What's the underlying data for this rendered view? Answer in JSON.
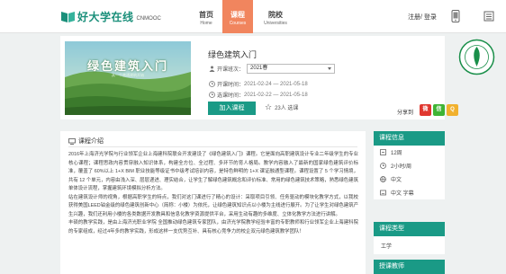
{
  "header": {
    "logo_text": "好大学在线",
    "logo_sub": "CNMOOC",
    "nav": [
      {
        "zh": "首页",
        "en": "Home"
      },
      {
        "zh": "课程",
        "en": "Courses"
      },
      {
        "zh": "院校",
        "en": "Universities"
      }
    ],
    "login_label": "注册/ 登录",
    "colors": {
      "brand": "#1a8f7a",
      "active_tab": "#f1855e"
    }
  },
  "course": {
    "thumbnail_title": "绿色建筑入门",
    "thumbnail_subtitle": "从一个普通建筑开始",
    "title": "绿色建筑入门",
    "term_label": "开课班次：",
    "term_value": "2021春",
    "start_label": "开课时间：",
    "start_value": "2021-02-24 — 2021-05-18",
    "elective_label": "选课时间：",
    "elective_value": "2021-02-22 — 2021-05-18",
    "join_button": "加入课程",
    "enrolled_count": "23人 选课",
    "share_label": "分享到",
    "share_buttons": [
      {
        "icon": "weibo-icon",
        "glyph": "微",
        "color": "#e0372f"
      },
      {
        "icon": "wechat-icon",
        "glyph": "信",
        "color": "#3fb435"
      },
      {
        "icon": "qq-zone-icon",
        "glyph": "Q",
        "color": "#f1b12e"
      }
    ]
  },
  "intro": {
    "heading": "课程介绍",
    "paragraphs": [
      "2016年上海济光学院与行业领军企业上海建科院联合开发建设了《绿色建筑入门》课程。它是面向高职建筑设计专业二年级学生的专业核心课程；课程思政内容贯穿融入知识体系，构建全方位、全过程、多环节的育人格局。教学内容融入了最新的国家绿色建筑评价标准，覆盖了 60%以上 1+X BIM 职业技能等级证书中级考试培训内容，是特色鲜明的 1+X 课证融通型课程。课程设置了 5 个学习情境，共有 12 个单元，内容由浅入深、层层递进、理实结合，让学生了解绿色建筑概念和评价标准、常用的绿色建筑技术策略，熟悉绿色建筑单体设计流程，掌握建筑环境模拟分析方法。",
      "站在建筑设计师的视角，根据高职学生的特点，我们对这门课进行了精心的设计：采取项目引领、任务驱动的模块化教学方式，以我校获得美国LEED铂金级的绿色建筑创新中心（简称：小楼）为依托，让绿色建筑知识点以小楼为主线进行展开。为了让学生对绿色建筑产生兴趣，我们还利用小楼的各类数据开发教具和信息化教学资源提供平台，采用生动有趣的多维度、立体化教学方法进行讲解。",
      "丰硕的教学实践，是由上海济光职业学院 全国推动绿色建筑专家团队，由济光学院教学经验丰富的专职教师和行业领军企业上海建科院的专家组成，经过4年多的教学实践，形成这样一支优势互补、具有核心竞争力的校企双元绿色建筑教学团队！"
    ]
  },
  "sidebar": {
    "info_title": "课程信息",
    "info_rows": [
      {
        "icon": "units-icon",
        "text": "12周"
      },
      {
        "icon": "clock-icon",
        "text": "2小时/周"
      },
      {
        "icon": "language-icon",
        "text": "中文"
      },
      {
        "icon": "subtitle-icon",
        "text": "中文 字幕"
      }
    ],
    "type_title": "课程类型",
    "type_value": "工学",
    "teacher_title": "授课教师"
  }
}
